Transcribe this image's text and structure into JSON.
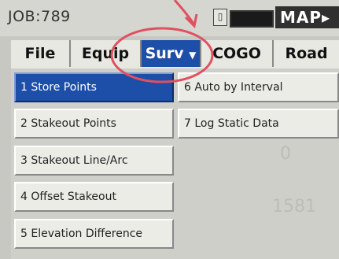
{
  "window": {
    "job_title": "JOB:789"
  },
  "status": {
    "sd_icon": "sd-card-icon",
    "battery_icon": "battery-icon"
  },
  "map_button": {
    "label": "MAP▸"
  },
  "tabs": [
    {
      "label": "File",
      "active": false
    },
    {
      "label": "Equip",
      "active": false
    },
    {
      "label": "Surv",
      "active": true
    },
    {
      "label": "COGO",
      "active": false
    },
    {
      "label": "Road",
      "active": false
    }
  ],
  "menu": {
    "left": [
      {
        "label": "1 Store Points",
        "selected": true
      },
      {
        "label": "2 Stakeout Points",
        "selected": false
      },
      {
        "label": "3 Stakeout Line/Arc",
        "selected": false
      },
      {
        "label": "4 Offset Stakeout",
        "selected": false
      },
      {
        "label": "5 Elevation Difference",
        "selected": false
      }
    ],
    "right": [
      {
        "label": "6 Auto by Interval",
        "selected": false
      },
      {
        "label": "7 Log Static Data",
        "selected": false
      }
    ]
  },
  "background_text": {
    "line1": "0",
    "line2": "1581"
  },
  "annotation": {
    "color": "#e05060"
  }
}
